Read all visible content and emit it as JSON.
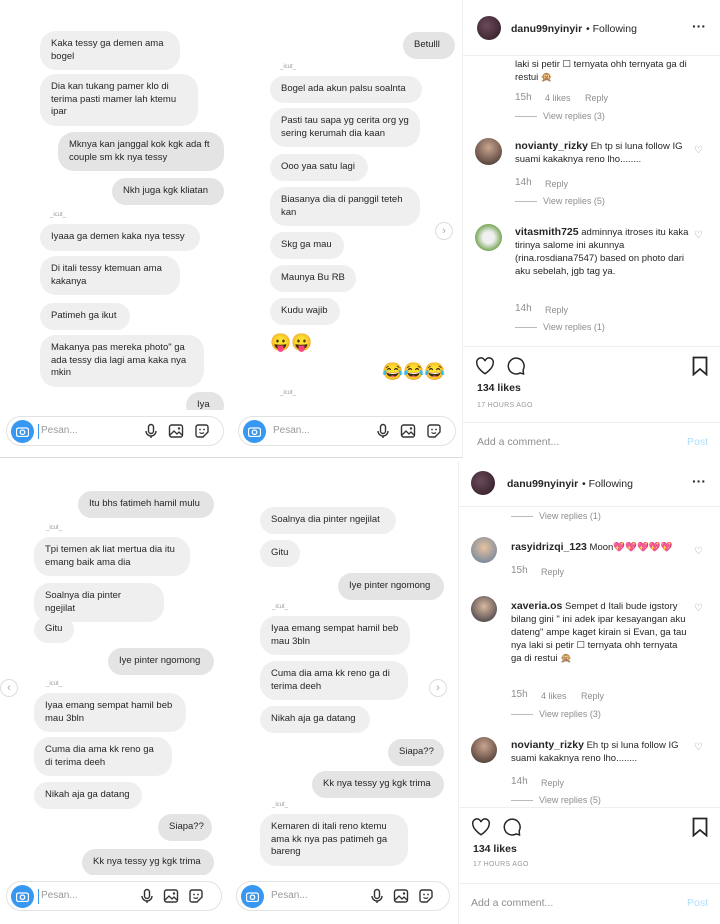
{
  "top": {
    "chat1": {
      "msgs": [
        "Kaka tessy ga demen ama bogel",
        "Dia kan tukang pamer klo di terima pasti mamer lah ktemu ipar",
        "Mknya kan janggal kok kgk ada ft couple sm kk nya tessy",
        "Nkh juga kgk kliatan",
        "Iyaaa ga demen kaka nya tessy",
        "Di itali tessy ktemuan ama kakanya",
        "Patimeh ga ikut",
        "Makanya pas mereka photo\" ga ada tessy dia lagi ama kaka nya mkin",
        "Iya"
      ],
      "tag": "_icut_",
      "placeholder": "Pesan..."
    },
    "chat2": {
      "msgs": [
        "Betulll",
        "Bogel ada akun palsu soalnta",
        "Pasti tau sapa yg cerita org yg sering kerumah dia kaan",
        "Ooo yaa satu lagi",
        "Biasanya dia di panggil teteh kan",
        "Skg ga mau",
        "Maunya Bu RB",
        "Kudu wajib"
      ],
      "emoji1": "😛😛",
      "emoji2": "😂😂😂",
      "tag": "_icut_",
      "placeholder": "Pesan..."
    },
    "ig": {
      "username": "danu99nyinyir",
      "following": "• Following",
      "more": "···",
      "c0": {
        "text": "laki si petir ☐ ternyata ohh ternyata ga di restui 🙊",
        "time": "15h",
        "likes": "4 likes",
        "reply": "Reply",
        "view": "View replies (3)"
      },
      "c1": {
        "user": "novianty_rizky",
        "text": "Eh tp si luna follow IG suami kakaknya reno lho........",
        "time": "14h",
        "reply": "Reply",
        "view": "View replies (5)"
      },
      "c2": {
        "user": "vitasmith725",
        "text": "adminnya itroses itu kaka tirinya salome ini akunnya (rina.rosdiana7547) based on photo dari aku sebelah, jgb tag ya.",
        "time": "14h",
        "reply": "Reply",
        "view": "View replies (1)"
      },
      "likes": "134 likes",
      "ago": "17 HOURS AGO",
      "add": "Add a comment...",
      "post": "Post"
    }
  },
  "bot": {
    "chat1": {
      "msgs": [
        "Itu bhs fatimeh hamil mulu",
        "Tpi temen ak liat mertua dia itu emang baik ama dia",
        "Soalnya dia pinter ngejilat",
        "Gitu",
        "Iye pinter ngomong",
        "Iyaa emang sempat hamil beb mau 3bln",
        "Cuma dia ama kk reno ga di terima deeh",
        "Nikah aja ga datang",
        "Siapa??",
        "Kk nya tessy yg kgk trima"
      ],
      "tag": "_icut_",
      "placeholder": "Pesan..."
    },
    "chat2": {
      "msgs": [
        "Soalnya dia pinter ngejilat",
        "Gitu",
        "Iye pinter ngomong",
        "Iyaa emang sempat hamil beb mau 3bln",
        "Cuma dia ama kk reno ga di terima deeh",
        "Nikah aja ga datang",
        "Siapa??",
        "Kk nya tessy yg kgk trima",
        "Kemaren di itali reno ktemu ama kk nya pas patimeh ga bareng"
      ],
      "tag": "_icut_",
      "placeholder": "Pesan..."
    },
    "ig": {
      "username": "danu99nyinyir",
      "following": "• Following",
      "more": "···",
      "view0": "View replies (1)",
      "c1": {
        "user": "rasyidrizqi_123",
        "text": "Moon💖💖💖💖💖",
        "time": "15h",
        "reply": "Reply"
      },
      "c2": {
        "user": "xaveria.os",
        "text": "Sempet d Itali bude igstory bilang gini \" ini adek ipar kesayangan aku dateng\" ampe kaget kirain si Evan, ga tau nya laki si petir ☐ ternyata ohh ternyata ga di restui 🙊",
        "time": "15h",
        "likes": "4 likes",
        "reply": "Reply",
        "view": "View replies (3)"
      },
      "c3": {
        "user": "novianty_rizky",
        "text": "Eh tp si luna follow IG suami kakaknya reno lho........",
        "time": "14h",
        "reply": "Reply",
        "view": "View replies (5)"
      },
      "likes": "134 likes",
      "ago": "17 HOURS AGO",
      "add": "Add a comment...",
      "post": "Post"
    }
  }
}
